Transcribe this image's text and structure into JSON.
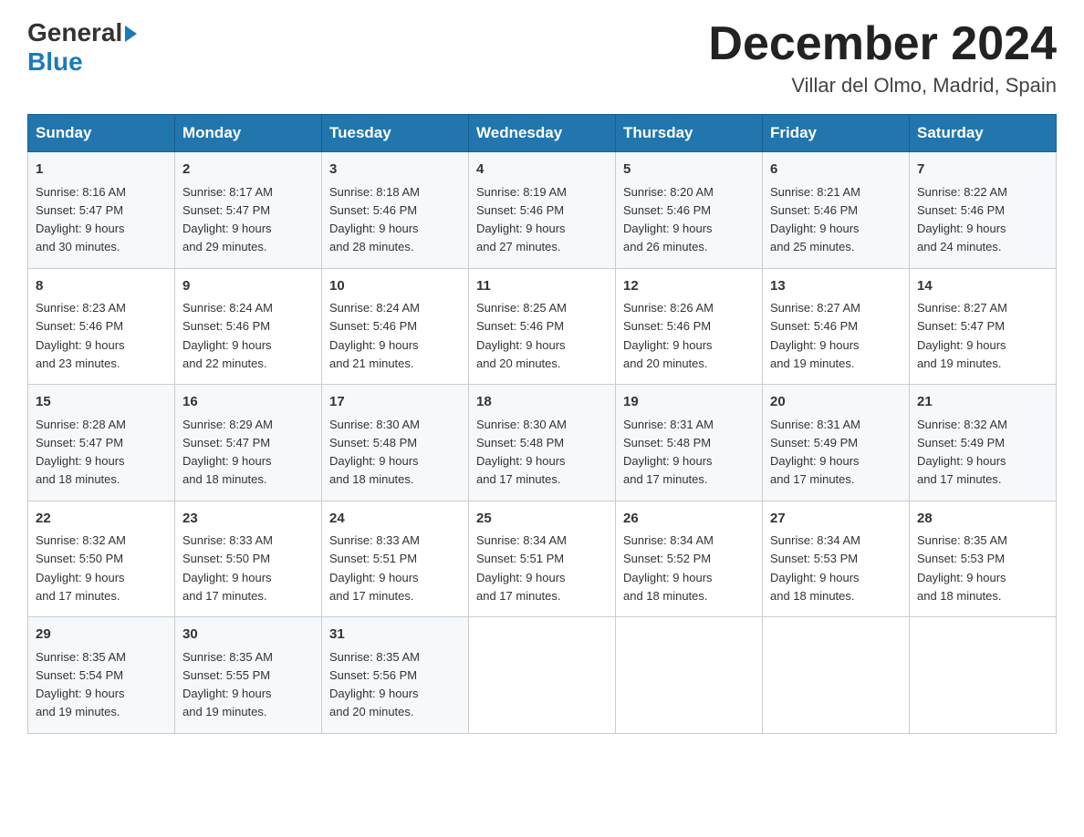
{
  "logo": {
    "general": "General",
    "blue": "Blue",
    "triangle": "▶"
  },
  "title": "December 2024",
  "location": "Villar del Olmo, Madrid, Spain",
  "days_of_week": [
    "Sunday",
    "Monday",
    "Tuesday",
    "Wednesday",
    "Thursday",
    "Friday",
    "Saturday"
  ],
  "weeks": [
    [
      {
        "day": "1",
        "sunrise": "8:16 AM",
        "sunset": "5:47 PM",
        "daylight": "9 hours and 30 minutes."
      },
      {
        "day": "2",
        "sunrise": "8:17 AM",
        "sunset": "5:47 PM",
        "daylight": "9 hours and 29 minutes."
      },
      {
        "day": "3",
        "sunrise": "8:18 AM",
        "sunset": "5:46 PM",
        "daylight": "9 hours and 28 minutes."
      },
      {
        "day": "4",
        "sunrise": "8:19 AM",
        "sunset": "5:46 PM",
        "daylight": "9 hours and 27 minutes."
      },
      {
        "day": "5",
        "sunrise": "8:20 AM",
        "sunset": "5:46 PM",
        "daylight": "9 hours and 26 minutes."
      },
      {
        "day": "6",
        "sunrise": "8:21 AM",
        "sunset": "5:46 PM",
        "daylight": "9 hours and 25 minutes."
      },
      {
        "day": "7",
        "sunrise": "8:22 AM",
        "sunset": "5:46 PM",
        "daylight": "9 hours and 24 minutes."
      }
    ],
    [
      {
        "day": "8",
        "sunrise": "8:23 AM",
        "sunset": "5:46 PM",
        "daylight": "9 hours and 23 minutes."
      },
      {
        "day": "9",
        "sunrise": "8:24 AM",
        "sunset": "5:46 PM",
        "daylight": "9 hours and 22 minutes."
      },
      {
        "day": "10",
        "sunrise": "8:24 AM",
        "sunset": "5:46 PM",
        "daylight": "9 hours and 21 minutes."
      },
      {
        "day": "11",
        "sunrise": "8:25 AM",
        "sunset": "5:46 PM",
        "daylight": "9 hours and 20 minutes."
      },
      {
        "day": "12",
        "sunrise": "8:26 AM",
        "sunset": "5:46 PM",
        "daylight": "9 hours and 20 minutes."
      },
      {
        "day": "13",
        "sunrise": "8:27 AM",
        "sunset": "5:46 PM",
        "daylight": "9 hours and 19 minutes."
      },
      {
        "day": "14",
        "sunrise": "8:27 AM",
        "sunset": "5:47 PM",
        "daylight": "9 hours and 19 minutes."
      }
    ],
    [
      {
        "day": "15",
        "sunrise": "8:28 AM",
        "sunset": "5:47 PM",
        "daylight": "9 hours and 18 minutes."
      },
      {
        "day": "16",
        "sunrise": "8:29 AM",
        "sunset": "5:47 PM",
        "daylight": "9 hours and 18 minutes."
      },
      {
        "day": "17",
        "sunrise": "8:30 AM",
        "sunset": "5:48 PM",
        "daylight": "9 hours and 18 minutes."
      },
      {
        "day": "18",
        "sunrise": "8:30 AM",
        "sunset": "5:48 PM",
        "daylight": "9 hours and 17 minutes."
      },
      {
        "day": "19",
        "sunrise": "8:31 AM",
        "sunset": "5:48 PM",
        "daylight": "9 hours and 17 minutes."
      },
      {
        "day": "20",
        "sunrise": "8:31 AM",
        "sunset": "5:49 PM",
        "daylight": "9 hours and 17 minutes."
      },
      {
        "day": "21",
        "sunrise": "8:32 AM",
        "sunset": "5:49 PM",
        "daylight": "9 hours and 17 minutes."
      }
    ],
    [
      {
        "day": "22",
        "sunrise": "8:32 AM",
        "sunset": "5:50 PM",
        "daylight": "9 hours and 17 minutes."
      },
      {
        "day": "23",
        "sunrise": "8:33 AM",
        "sunset": "5:50 PM",
        "daylight": "9 hours and 17 minutes."
      },
      {
        "day": "24",
        "sunrise": "8:33 AM",
        "sunset": "5:51 PM",
        "daylight": "9 hours and 17 minutes."
      },
      {
        "day": "25",
        "sunrise": "8:34 AM",
        "sunset": "5:51 PM",
        "daylight": "9 hours and 17 minutes."
      },
      {
        "day": "26",
        "sunrise": "8:34 AM",
        "sunset": "5:52 PM",
        "daylight": "9 hours and 18 minutes."
      },
      {
        "day": "27",
        "sunrise": "8:34 AM",
        "sunset": "5:53 PM",
        "daylight": "9 hours and 18 minutes."
      },
      {
        "day": "28",
        "sunrise": "8:35 AM",
        "sunset": "5:53 PM",
        "daylight": "9 hours and 18 minutes."
      }
    ],
    [
      {
        "day": "29",
        "sunrise": "8:35 AM",
        "sunset": "5:54 PM",
        "daylight": "9 hours and 19 minutes."
      },
      {
        "day": "30",
        "sunrise": "8:35 AM",
        "sunset": "5:55 PM",
        "daylight": "9 hours and 19 minutes."
      },
      {
        "day": "31",
        "sunrise": "8:35 AM",
        "sunset": "5:56 PM",
        "daylight": "9 hours and 20 minutes."
      },
      null,
      null,
      null,
      null
    ]
  ],
  "labels": {
    "sunrise": "Sunrise:",
    "sunset": "Sunset:",
    "daylight": "Daylight:"
  }
}
